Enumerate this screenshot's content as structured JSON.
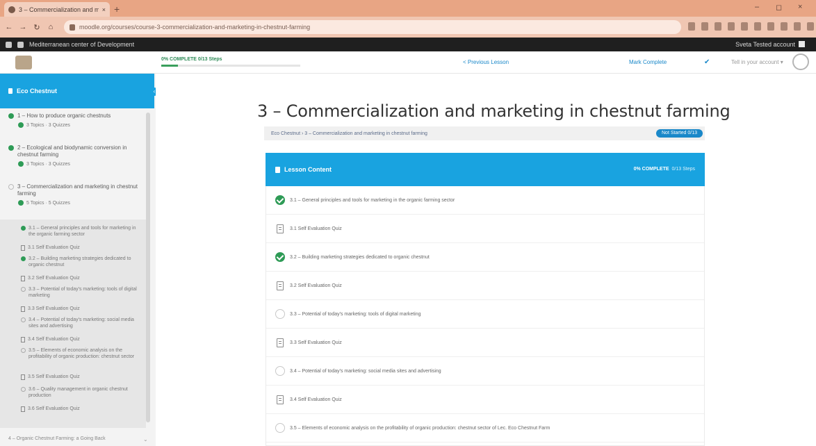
{
  "browser": {
    "tab_title": "3 – Commercialization and mar",
    "tab_close": "×",
    "new_tab": "+",
    "window_controls": [
      "–",
      "◻",
      "×"
    ],
    "nav": [
      "←",
      "→",
      "↻",
      "⌂"
    ],
    "url": "moodle.org/courses/course-3-commercialization-and-marketing-in-chestnut-farming",
    "bookmark_label": "Mediterranean center of Development",
    "user_label": "Sveta Tested account"
  },
  "header": {
    "progress_label": "0% COMPLETE  0/13 Steps",
    "progress_fraction": 0.12,
    "prev_label": "< Previous Lesson",
    "next_label": "Mark Complete",
    "check_icon": "✔",
    "user_label": "Tell in your account ▾"
  },
  "sidebar": {
    "course_title": "Eco Chestnut",
    "toggle": "‹",
    "lessons": [
      {
        "title": "1 – How to produce organic chestnuts",
        "meta": "3 Topics  ·  3 Quizzes",
        "done": true
      },
      {
        "title": "2 – Ecological and biodynamic conversion in chestnut farming",
        "meta": "3 Topics  ·  3 Quizzes",
        "done": true
      },
      {
        "title": "3 – Commercialization and marketing in chestnut farming",
        "meta": "5 Topics  ·  5 Quizzes",
        "done": false
      }
    ],
    "topics": [
      {
        "kind": "done",
        "text": "3.1 – General principles and tools for marketing in the organic farming sector"
      },
      {
        "kind": "quiz",
        "text": "3.1 Self Evaluation Quiz"
      },
      {
        "kind": "done",
        "text": "3.2 – Building marketing strategies dedicated to organic chestnut"
      },
      {
        "kind": "quiz",
        "text": "3.2 Self Evaluation Quiz"
      },
      {
        "kind": "open",
        "text": "3.3 – Potential of today's marketing: tools of digital marketing"
      },
      {
        "kind": "quiz",
        "text": "3.3 Self Evaluation Quiz"
      },
      {
        "kind": "open",
        "text": "3.4 – Potential of today's marketing: social media sites and advertising"
      },
      {
        "kind": "quiz",
        "text": "3.4 Self Evaluation Quiz"
      },
      {
        "kind": "open",
        "text": "3.5 – Elements of economic analysis on the profitability of organic production: chestnut sector"
      },
      {
        "kind": "quiz",
        "text": "3.5 Self Evaluation Quiz"
      },
      {
        "kind": "open",
        "text": "3.6 – Quality management in organic chestnut production"
      },
      {
        "kind": "quiz",
        "text": "3.6 Self Evaluation Quiz"
      }
    ],
    "next_lesson": "4 – Organic Chestnut Farming: a Going Back",
    "next_chevron": "⌄"
  },
  "main": {
    "title": "3 – Commercialization and marketing in chestnut farming",
    "breadcrumb": "Eco Chestnut  ›  3 – Commercialization and marketing in chestnut farming",
    "status_badge": "Not Started 0/13",
    "content_title": "Lesson Content",
    "content_status": "0% COMPLETE",
    "content_steps": "0/13 Steps",
    "rows": [
      {
        "kind": "done",
        "text": "3.1 – General principles and tools for marketing in the organic farming sector"
      },
      {
        "kind": "quiz",
        "text": "3.1 Self Evaluation Quiz"
      },
      {
        "kind": "done",
        "text": "3.2 – Building marketing strategies dedicated to organic chestnut"
      },
      {
        "kind": "quiz",
        "text": "3.2 Self Evaluation Quiz"
      },
      {
        "kind": "open",
        "text": "3.3 – Potential of today's marketing: tools of digital marketing"
      },
      {
        "kind": "quiz",
        "text": "3.3 Self Evaluation Quiz"
      },
      {
        "kind": "open",
        "text": "3.4 – Potential of today's marketing: social media sites and advertising"
      },
      {
        "kind": "quiz",
        "text": "3.4 Self Evaluation Quiz"
      },
      {
        "kind": "open",
        "text": "3.5 – Elements of economic analysis on the profitability of organic production: chestnut sector of Lec. Eco Chestnut Farm"
      }
    ]
  }
}
